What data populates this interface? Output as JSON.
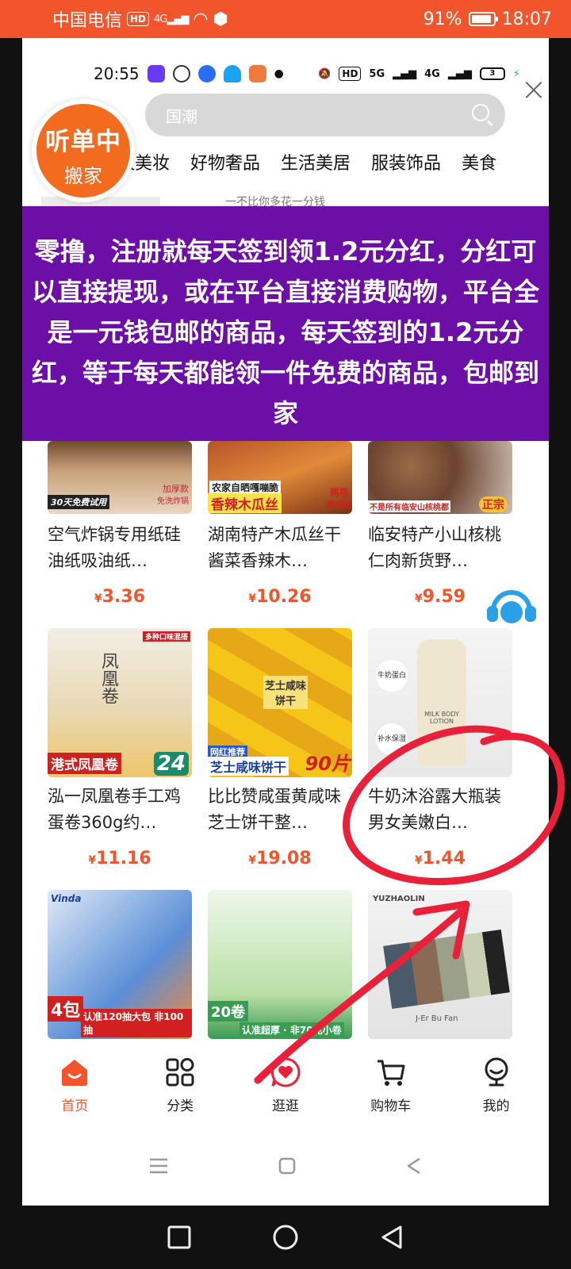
{
  "outer_status": {
    "carrier": "中国电信",
    "hd": "HD",
    "network": "4G",
    "battery": "91%",
    "time": "18:07"
  },
  "inner_status": {
    "time": "20:55",
    "hd": "HD",
    "net1": "5G",
    "net2": "4G",
    "battery": "3"
  },
  "floating_badge": {
    "line1": "听单中",
    "line2": "搬家"
  },
  "search": {
    "placeholder": "国潮"
  },
  "categories": [
    "致美妆",
    "好物奢品",
    "生活美居",
    "服装饰品",
    "美食"
  ],
  "banner_peek": "一不比你多花一分钱",
  "overlay_text": "零撸，注册就每天签到领1.2元分红，分红可以直接提现，或在平台直接消费购物，平台全是一元钱包邮的商品，每天签到的1.2元分红，等于每天都能领一件免费的商品，包邮到家",
  "products": [
    {
      "title": "空气炸锅专用纸硅油纸吸油纸…",
      "price": "3.36",
      "currency": "¥",
      "tag1": "30天免费试用",
      "tag2": "加厚款",
      "tag3": "免洗炸锅"
    },
    {
      "title": "湖南特产木瓜丝干酱菜香辣木…",
      "price": "10.26",
      "currency": "¥",
      "tag1": "农家自晒嘎嘣脆",
      "tag2": "香辣木瓜丝",
      "tag3": "两瓶",
      "tag4": "更划算"
    },
    {
      "title": "临安特产小山核桃仁肉新货野…",
      "price": "9.59",
      "currency": "¥",
      "tag1": "不是所有临安山核桃都",
      "tag2": "正宗"
    },
    {
      "title": "泓一凤凰卷手工鸡蛋卷360g约…",
      "price": "11.16",
      "currency": "¥",
      "tag1": "港式凤凰卷",
      "tag2": "24",
      "tag3": "多种口味混搭",
      "tag4": "凤凰卷"
    },
    {
      "title": "比比赞咸蛋黄咸味芝士饼干整…",
      "price": "19.08",
      "currency": "¥",
      "tag1": "网红推荐",
      "tag2": "芝士咸味饼干",
      "tag3": "90片",
      "tag4": "芝士咸味饼干"
    },
    {
      "title": "牛奶沐浴露大瓶装男女美嫩白…",
      "price": "1.44",
      "currency": "¥",
      "tag1": "MILK BODY LOTION",
      "tag2": "牛奶蛋白",
      "tag3": "补水保湿"
    },
    {
      "title": "",
      "price": "",
      "currency": "",
      "tag1": "认准120抽大包 非100抽",
      "tag2": "4包",
      "tag3": "Vinda"
    },
    {
      "title": "",
      "price": "",
      "currency": "",
      "tag1": "认准超厚 · 非70克小卷",
      "tag2": "20卷"
    },
    {
      "title": "",
      "price": "",
      "currency": "",
      "tag1": "YUZHAOLIN",
      "tag2": "J-Er Bu Fan"
    }
  ],
  "tabbar": [
    {
      "label": "首页",
      "icon": "home-icon"
    },
    {
      "label": "分类",
      "icon": "grid-icon"
    },
    {
      "label": "逛逛",
      "icon": "heart-chat-icon"
    },
    {
      "label": "购物车",
      "icon": "cart-icon"
    },
    {
      "label": "我的",
      "icon": "profile-icon"
    }
  ],
  "colors": {
    "accent": "#f2542b",
    "overlay": "#6b0fa6",
    "badge": "#f36b1f",
    "annotation": "#e8203a"
  }
}
